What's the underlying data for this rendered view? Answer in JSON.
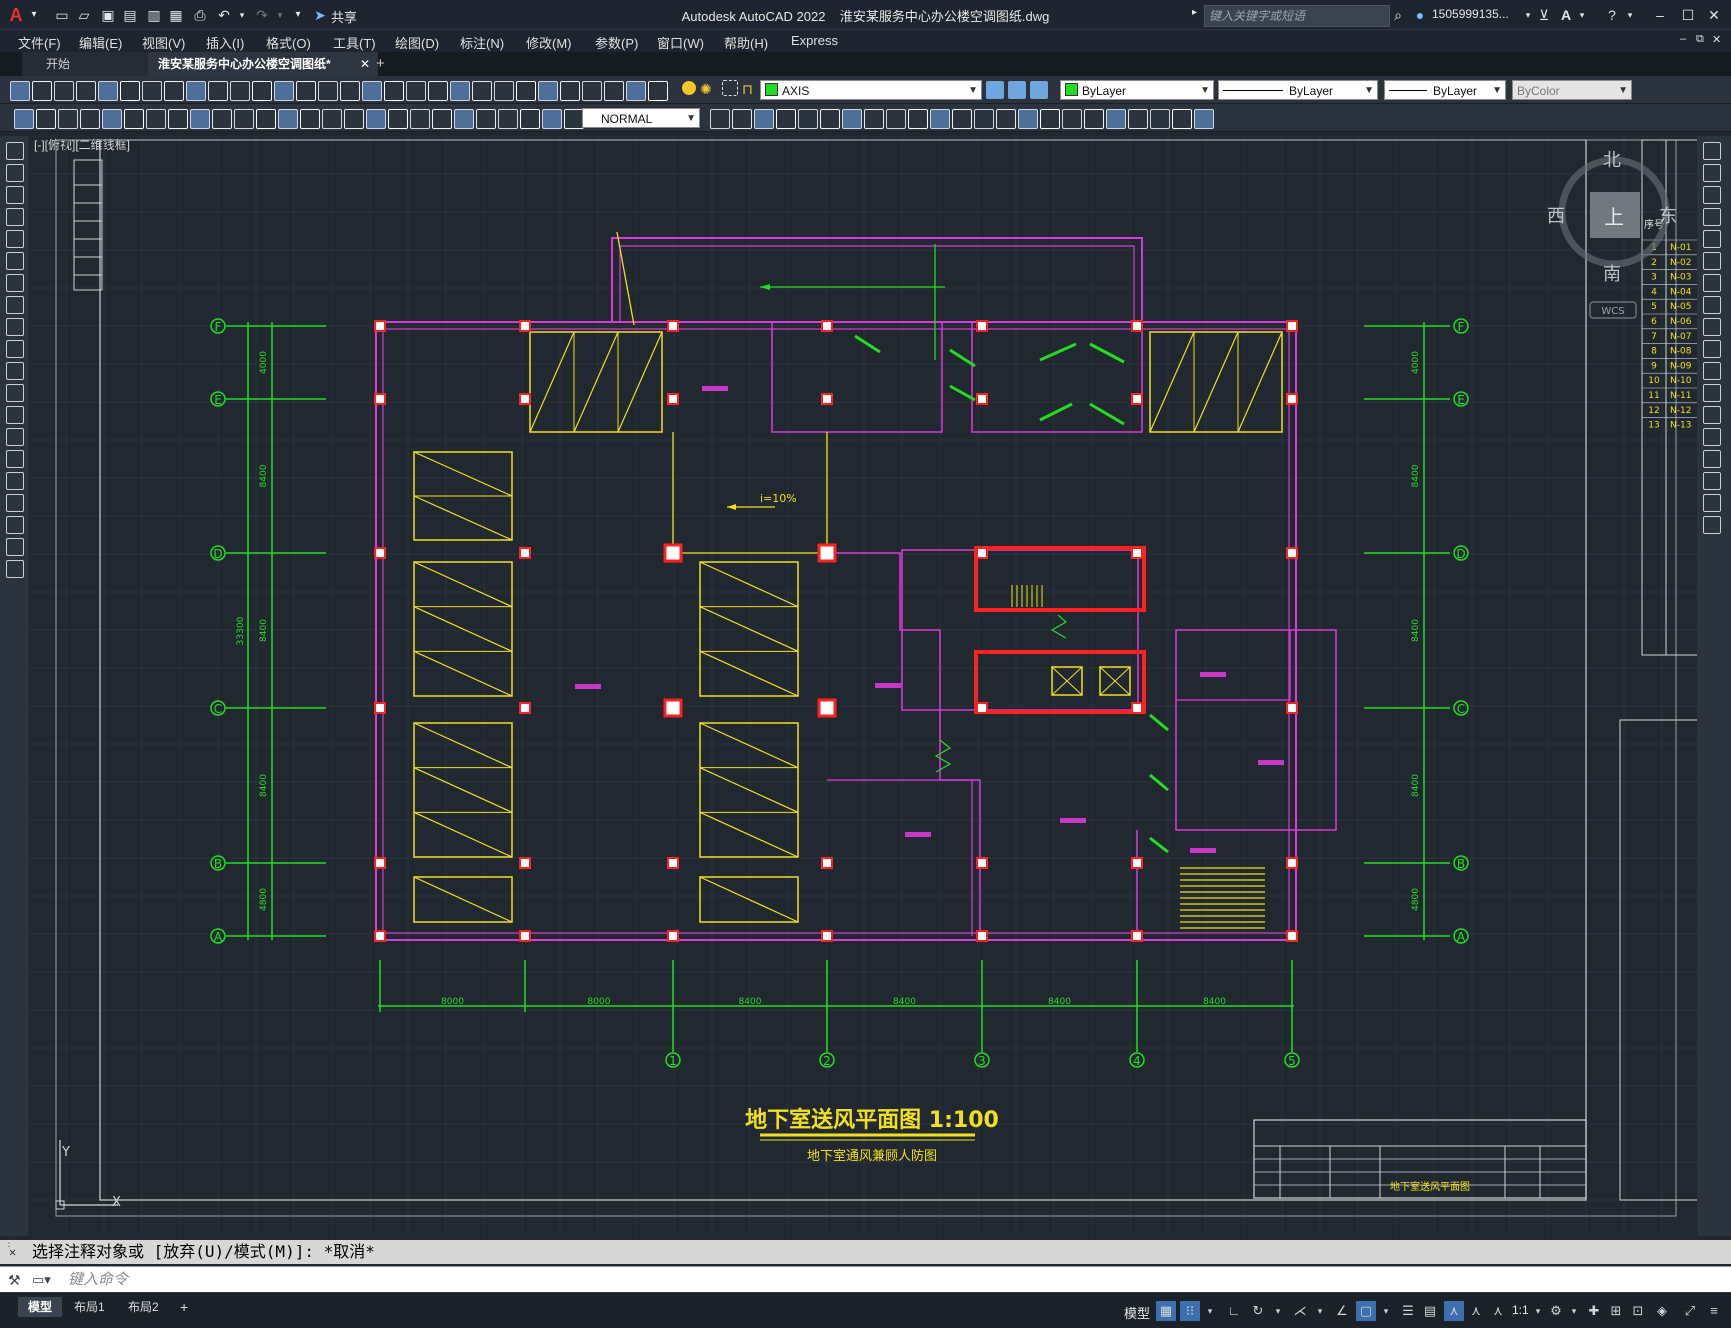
{
  "titlebar": {
    "app_name": "Autodesk AutoCAD 2022",
    "file_name": "淮安某服务中心办公楼空调图纸.dwg",
    "share_label": "共享",
    "search_placeholder": "键入关键字或短语",
    "user_name": "1505999135..."
  },
  "menu": [
    "文件(F)",
    "编辑(E)",
    "视图(V)",
    "插入(I)",
    "格式(O)",
    "工具(T)",
    "绘图(D)",
    "标注(N)",
    "修改(M)",
    "参数(P)",
    "窗口(W)",
    "帮助(H)",
    "Express"
  ],
  "tabs": {
    "start": "开始",
    "active": "淮安某服务中心办公楼空调图纸*",
    "add": "+"
  },
  "toolbar": {
    "layer_combo": "AXIS",
    "color_combo": "ByLayer",
    "linetype_combo": "ByLayer",
    "lineweight_combo": "ByLayer",
    "plotstyle_combo": "ByColor",
    "textstyle_combo": "NORMAL"
  },
  "viewport_label": "[-][俯视][二维线框]",
  "viewcube": {
    "north": "北",
    "south": "南",
    "east": "东",
    "west": "西",
    "top": "上",
    "wcs": "WCS"
  },
  "drawing": {
    "title": "地下室送风平面图 1:100",
    "subtitle": "地下室通风兼顾人防图",
    "slope_note": "i=10%",
    "row_axes": [
      "F",
      "E",
      "D",
      "C",
      "B",
      "A"
    ],
    "col_axes": [
      "1",
      "2",
      "3",
      "4",
      "5"
    ],
    "col_dims": [
      "8000",
      "8000",
      "8400",
      "8400",
      "8400",
      "8400"
    ],
    "row_dims": [
      "4000",
      "8400",
      "8400",
      "8400",
      "4800"
    ],
    "total_dim": "33300",
    "title_block_name": "地下室送风平面图",
    "right_table": {
      "header": "序号",
      "rows": [
        [
          "1",
          "N-01"
        ],
        [
          "2",
          "N-02"
        ],
        [
          "3",
          "N-03"
        ],
        [
          "4",
          "N-04"
        ],
        [
          "5",
          "N-05"
        ],
        [
          "6",
          "N-06"
        ],
        [
          "7",
          "N-07"
        ],
        [
          "8",
          "N-08"
        ],
        [
          "9",
          "N-09"
        ],
        [
          "10",
          "N-10"
        ],
        [
          "11",
          "N-11"
        ],
        [
          "12",
          "N-12"
        ],
        [
          "13",
          "N-13"
        ]
      ]
    }
  },
  "command": {
    "history": "选择注释对象或 [放弃(U)/模式(M)]: *取消*",
    "input_placeholder": "键入命令"
  },
  "status": {
    "layout_tabs": [
      "模型",
      "布局1",
      "布局2",
      "+"
    ],
    "model_label": "模型",
    "scale": "1:1"
  },
  "colors": {
    "wall": "#d93ad9",
    "axis": "#22dd22",
    "yellow": "#f0e020",
    "column_red": "#ff2020",
    "background": "#212830"
  }
}
